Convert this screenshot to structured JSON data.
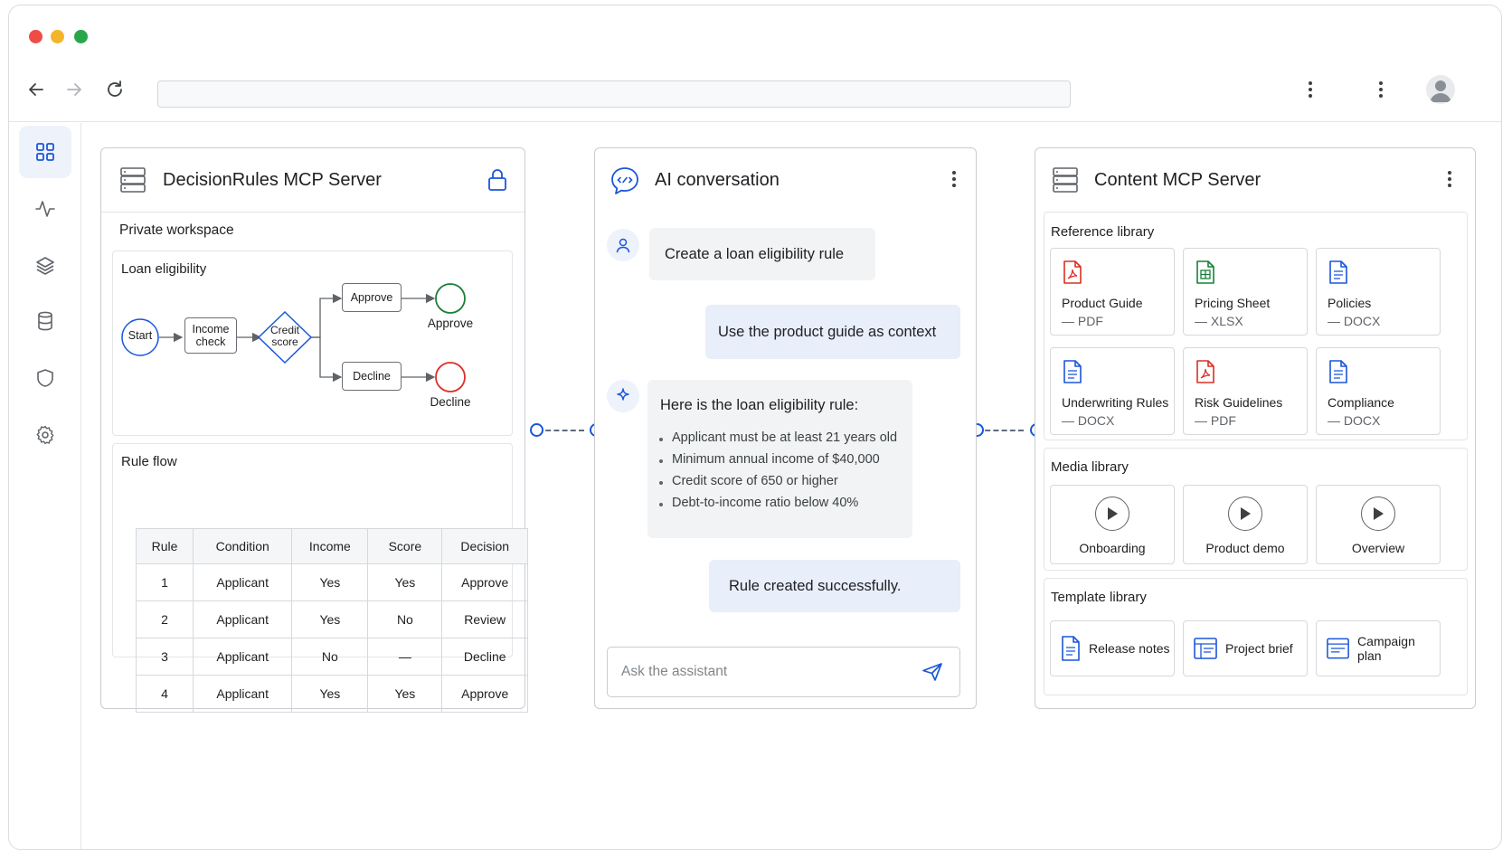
{
  "browser": {
    "address": ""
  },
  "sidebar": {
    "items": [
      "dashboard-icon",
      "activity-icon",
      "layers-icon",
      "database-icon",
      "shield-icon",
      "gear-icon"
    ]
  },
  "left_panel": {
    "title": "DecisionRules MCP Server",
    "section": "Private workspace",
    "flow": {
      "title": "Loan eligibility",
      "start": "Start",
      "income_check": "Income check",
      "credit_score": "Credit score",
      "approve_box": "Approve",
      "decline_box": "Decline",
      "approve_end": "Approve",
      "decline_end": "Decline"
    },
    "rule_flow": {
      "title": "Rule flow",
      "columns": [
        "Rule",
        "Condition",
        "Income",
        "Score",
        "Decision"
      ],
      "rows": [
        [
          "1",
          "Applicant",
          "Yes",
          "Yes",
          "Approve"
        ],
        [
          "2",
          "Applicant",
          "Yes",
          "No",
          "Review"
        ],
        [
          "3",
          "Applicant",
          "No",
          "—",
          "Decline"
        ],
        [
          "4",
          "Applicant",
          "Yes",
          "Yes",
          "Approve"
        ]
      ]
    }
  },
  "chat": {
    "title": "AI conversation",
    "messages": {
      "user1": "Create a loan eligibility rule",
      "user2": "Use the product guide as context",
      "assistant_intro": "Here is the loan eligibility rule:",
      "bullets": [
        "Applicant must be at least 21 years old",
        "Minimum annual income of $40,000",
        "Credit score of 650 or higher",
        "Debt-to-income ratio below 40%"
      ],
      "user3": "Rule created successfully."
    },
    "input_placeholder": "Ask the assistant"
  },
  "right_panel": {
    "title": "Content MCP Server",
    "reference": {
      "title": "Reference library",
      "items": [
        {
          "name": "Product Guide",
          "type": "— PDF",
          "icon": "pdf-icon",
          "color": "#d93025"
        },
        {
          "name": "Pricing Sheet",
          "type": "— XLSX",
          "icon": "sheet-icon",
          "color": "#188038"
        },
        {
          "name": "Policies",
          "type": "— DOCX",
          "icon": "doc-icon",
          "color": "#1a56db"
        },
        {
          "name": "Underwriting Rules",
          "type": "— DOCX",
          "icon": "doc-icon",
          "color": "#1a56db"
        },
        {
          "name": "Risk Guidelines",
          "type": "— PDF",
          "icon": "pdf-icon",
          "color": "#d93025"
        },
        {
          "name": "Compliance",
          "type": "— DOCX",
          "icon": "doc-icon",
          "color": "#1a56db"
        }
      ]
    },
    "media": {
      "title": "Media library",
      "items": [
        "Onboarding",
        "Product demo",
        "Overview"
      ]
    },
    "templates": {
      "title": "Template library",
      "items": [
        "Release notes",
        "Project brief",
        "Campaign plan"
      ]
    }
  },
  "colors": {
    "accent": "#1a56db",
    "pdf": "#d93025",
    "sheet": "#188038"
  }
}
